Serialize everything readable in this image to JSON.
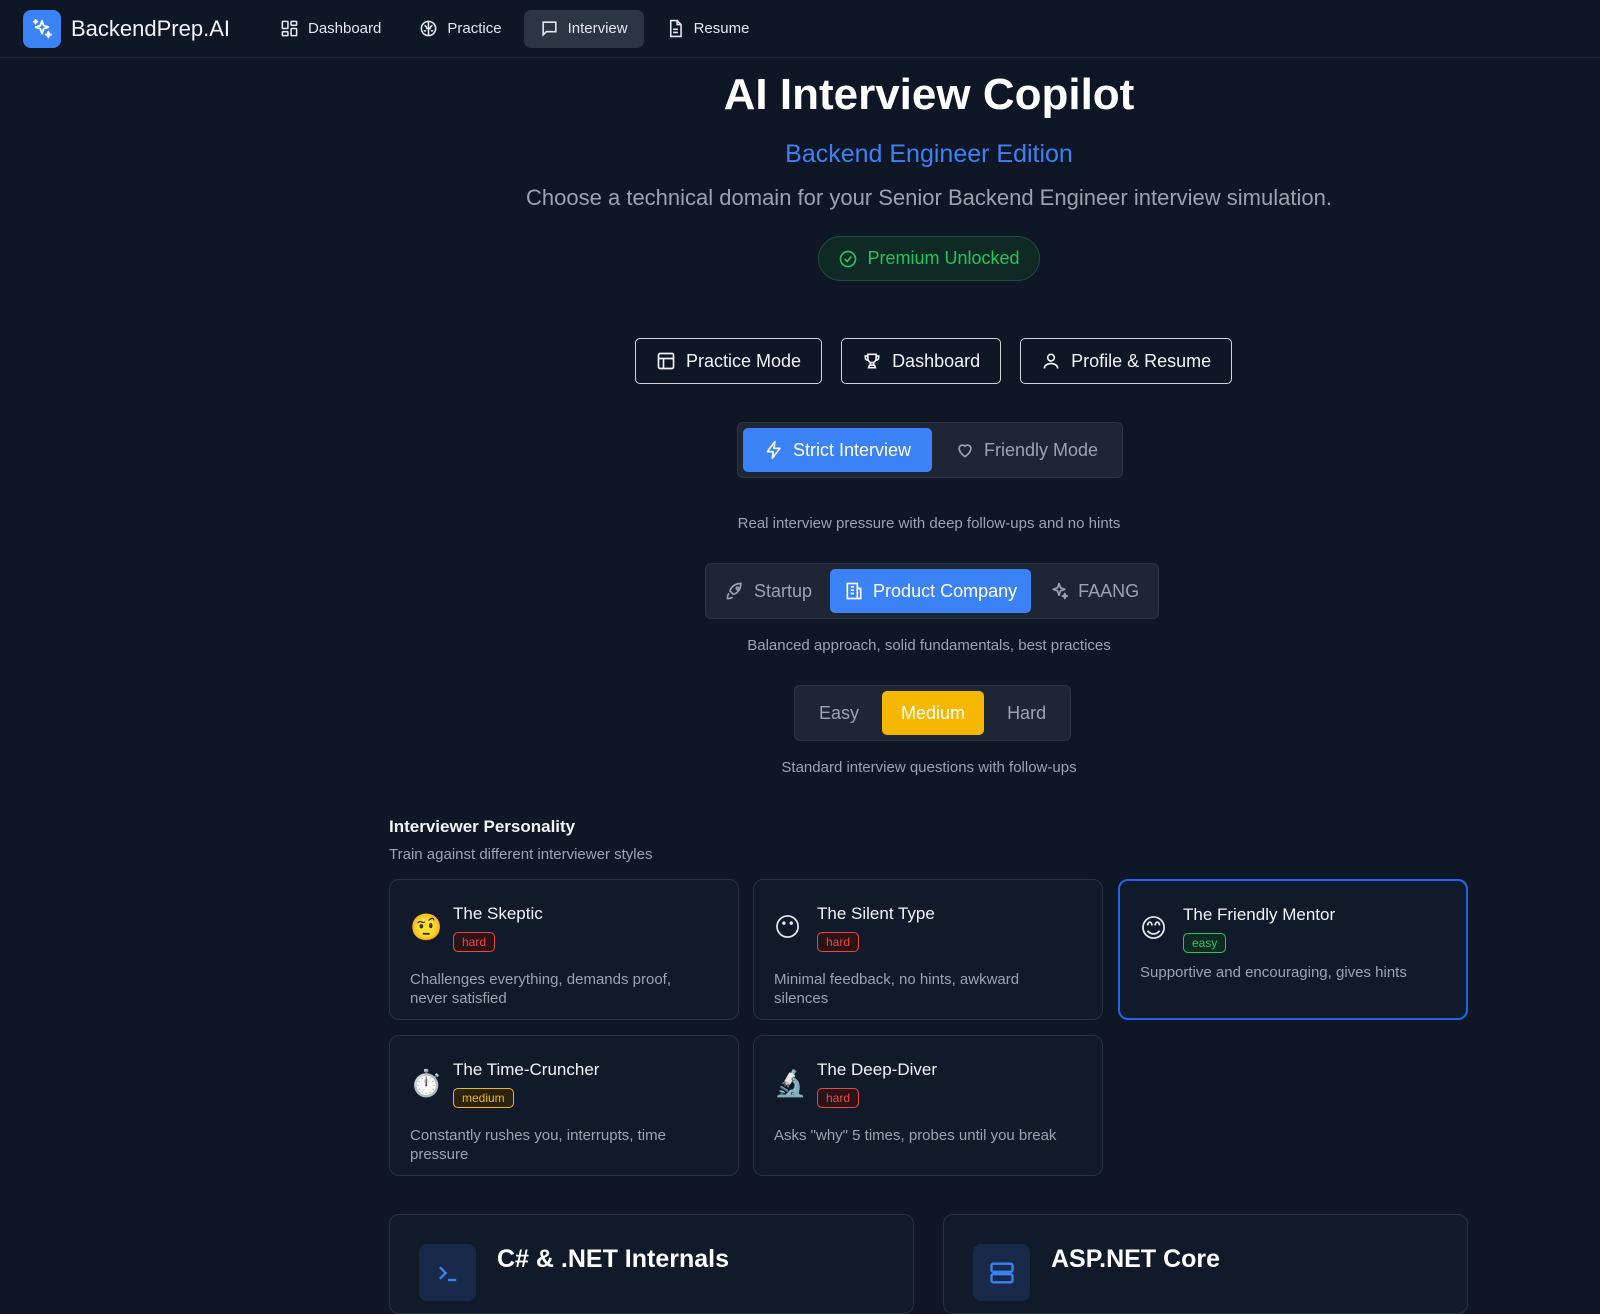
{
  "brand": {
    "name": "BackendPrep.AI",
    "logo_icon": "sparkles-icon",
    "accent": "#3b82f6"
  },
  "nav": [
    {
      "label": "Dashboard",
      "icon": "grid-icon",
      "active": false
    },
    {
      "label": "Practice",
      "icon": "brain-icon",
      "active": false
    },
    {
      "label": "Interview",
      "icon": "chat-icon",
      "active": true
    },
    {
      "label": "Resume",
      "icon": "document-icon",
      "active": false
    }
  ],
  "hero": {
    "title": "AI Interview Copilot",
    "subtitle": "Backend Engineer Edition",
    "description": "Choose a technical domain for your Senior Backend Engineer interview simulation.",
    "premium_label": "Premium Unlocked",
    "premium_color": "#22c55e"
  },
  "quick_actions": {
    "practice": "Practice Mode",
    "dashboard": "Dashboard",
    "profile": "Profile & Resume"
  },
  "interview_mode": {
    "options": [
      "Strict Interview",
      "Friendly Mode"
    ],
    "selected": "Strict Interview",
    "caption": "Real interview pressure with deep follow-ups and no hints"
  },
  "company_type": {
    "options": [
      "Startup",
      "Product Company",
      "FAANG"
    ],
    "selected": "Product Company",
    "caption": "Balanced approach, solid fundamentals, best practices"
  },
  "difficulty": {
    "options": [
      "Easy",
      "Medium",
      "Hard"
    ],
    "selected": "Medium",
    "caption": "Standard interview questions with follow-ups",
    "selected_color": "#f5b700"
  },
  "personality": {
    "title": "Interviewer Personality",
    "subtitle": "Train against different interviewer styles",
    "cards": [
      {
        "emoji": "🤨",
        "name": "The Skeptic",
        "level": "hard",
        "desc": "Challenges everything, demands proof, never satisfied",
        "selected": false
      },
      {
        "emoji": "😶",
        "name": "The Silent Type",
        "level": "hard",
        "desc": "Minimal feedback, no hints, awkward silences",
        "selected": false
      },
      {
        "emoji": "😊",
        "name": "The Friendly Mentor",
        "level": "easy",
        "desc": "Supportive and encouraging, gives hints",
        "selected": true
      },
      {
        "emoji": "⏱️",
        "name": "The Time-Cruncher",
        "level": "medium",
        "desc": "Constantly rushes you, interrupts, time pressure",
        "selected": false
      },
      {
        "emoji": "🔬",
        "name": "The Deep-Diver",
        "level": "hard",
        "desc": "Asks \"why\" 5 times, probes until you break",
        "selected": false
      }
    ]
  },
  "domains": [
    {
      "title": "C# & .NET Internals",
      "icon": "terminal-icon"
    },
    {
      "title": "ASP.NET Core",
      "icon": "server-icon"
    }
  ]
}
